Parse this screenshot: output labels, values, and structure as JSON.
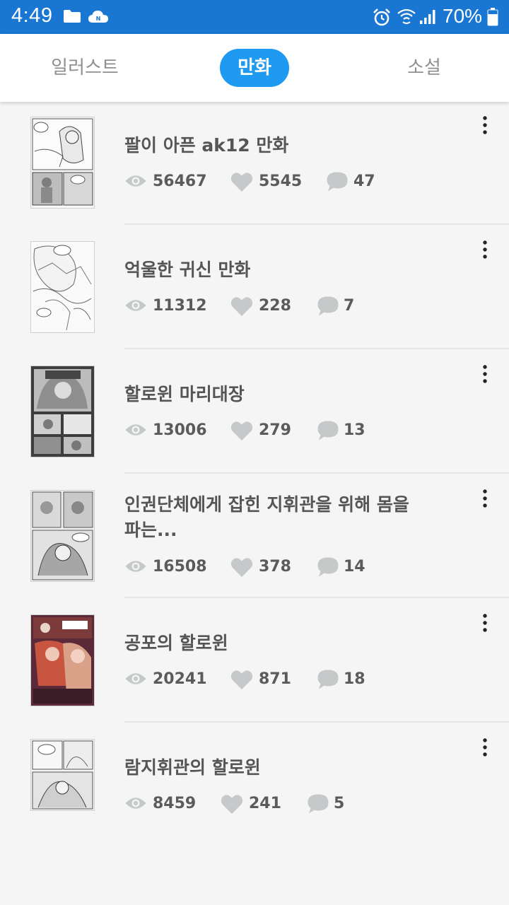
{
  "status_bar": {
    "time": "4:49",
    "battery": "70%"
  },
  "tabs": [
    {
      "label": "일러스트",
      "active": false
    },
    {
      "label": "만화",
      "active": true
    },
    {
      "label": "소설",
      "active": false
    }
  ],
  "accent_color": "#1e9af0",
  "status_bar_color": "#1976d2",
  "items": [
    {
      "title": "팔이 아픈 ak12 만화",
      "views": "56467",
      "likes": "5545",
      "comments": "47"
    },
    {
      "title": "억울한 귀신 만화",
      "views": "11312",
      "likes": "228",
      "comments": "7"
    },
    {
      "title": "할로윈 마리대장",
      "views": "13006",
      "likes": "279",
      "comments": "13"
    },
    {
      "title": "인권단체에게 잡힌 지휘관을 위해 몸을파는...",
      "views": "16508",
      "likes": "378",
      "comments": "14"
    },
    {
      "title": "공포의 할로윈",
      "views": "20241",
      "likes": "871",
      "comments": "18"
    },
    {
      "title": "람지휘관의 할로윈",
      "views": "8459",
      "likes": "241",
      "comments": "5"
    }
  ]
}
